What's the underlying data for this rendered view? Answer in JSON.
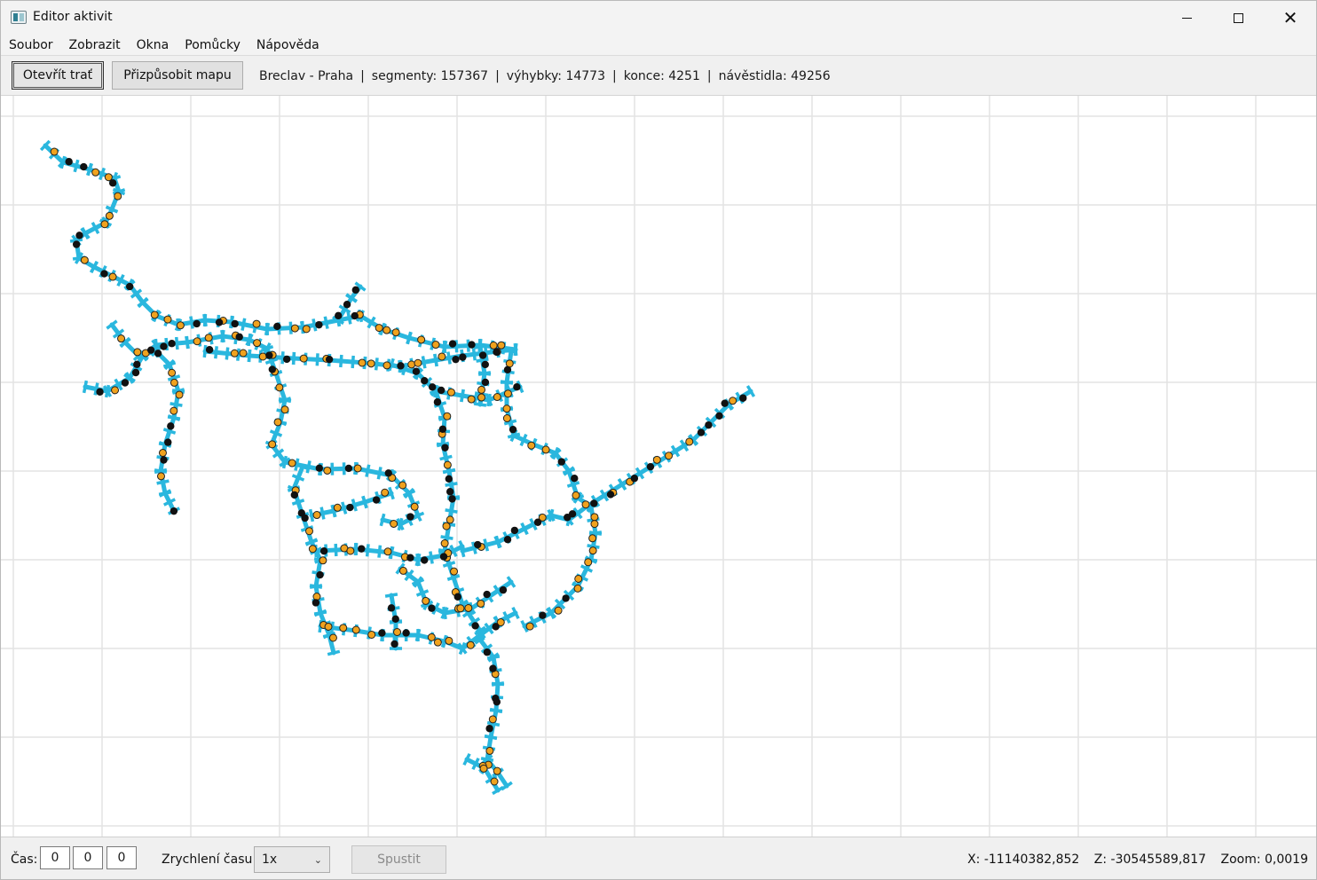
{
  "window": {
    "title": "Editor aktivit",
    "minimize_glyph": "—",
    "close_glyph": "✕"
  },
  "menu": {
    "items": [
      "Soubor",
      "Zobrazit",
      "Okna",
      "Pomůcky",
      "Nápověda"
    ]
  },
  "toolbar": {
    "open_label": "Otevřít trať",
    "fit_label": "Přizpůsobit mapu",
    "route": "Breclav - Praha",
    "segments": "segmenty: 157367",
    "switches": "výhybky: 14773",
    "ends": "konce: 4251",
    "signals": "návěstidla: 49256",
    "separator": "|"
  },
  "map": {
    "track_color": "#2ab7de",
    "switch_color": "#f0a21e",
    "end_color": "#111111",
    "grid_color": "#e3e3e3",
    "icons": [
      "grid",
      "track-line",
      "switch-marker",
      "end-marker"
    ]
  },
  "statusbar": {
    "time_label": "Čas:",
    "hours": "0",
    "minutes": "0",
    "seconds": "0",
    "speed_label": "Zrychlení času",
    "speed_value": "1x",
    "run_label": "Spustit",
    "x_coord": "X: -11140382,852",
    "z_coord": "Z: -30545589,817",
    "zoom": "Zoom: 0,0019"
  }
}
